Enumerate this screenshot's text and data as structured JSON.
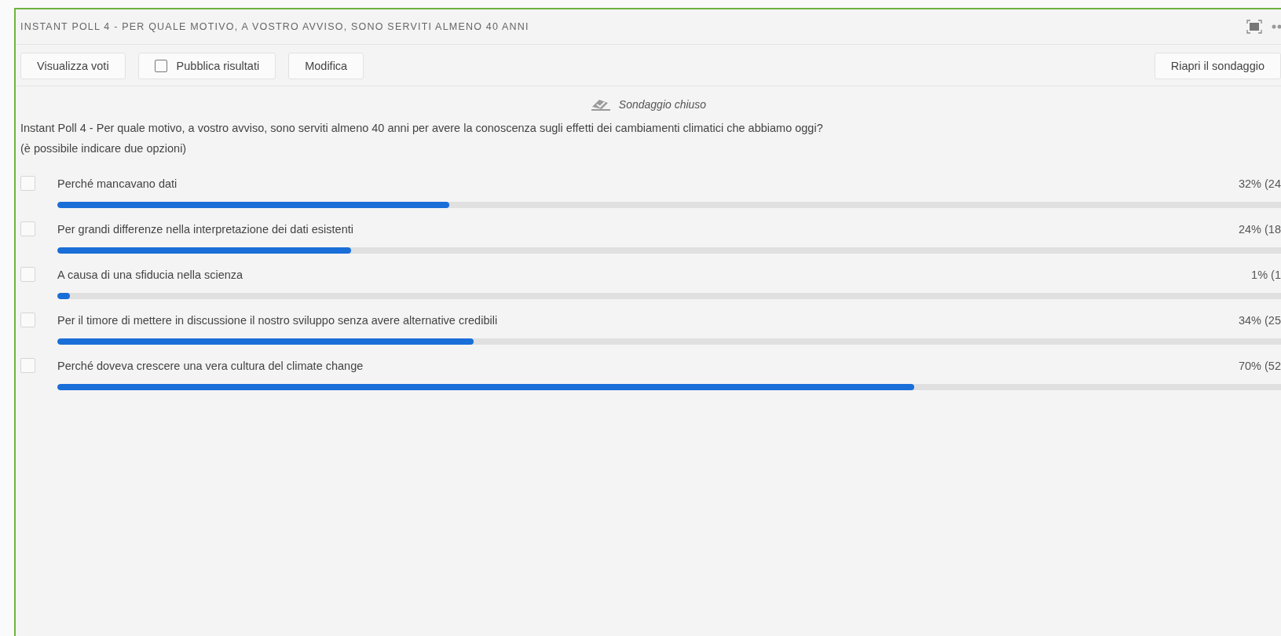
{
  "panel": {
    "title": "INSTANT POLL 4 - PER QUALE MOTIVO, A VOSTRO AVVISO, SONO SERVITI ALMENO 40 ANNI"
  },
  "toolbar": {
    "view_votes": "Visualizza voti",
    "publish": {
      "label": "Pubblica risultati",
      "checked": false
    },
    "edit": "Modifica",
    "reopen": "Riapri il sondaggio"
  },
  "status": "Sondaggio chiuso",
  "question": [
    "Instant Poll 4 - Per quale motivo, a vostro avviso, sono serviti almeno 40 anni per avere la conoscenza sugli effetti dei cambiamenti climatici che abbiamo oggi?",
    "(è possibile indicare due opzioni)"
  ],
  "options": [
    {
      "label": "Perché mancavano dati",
      "checked": false,
      "level": 0.32,
      "result": "32% (24"
    },
    {
      "label": "Per grandi differenze nella interpretazione dei dati esistenti",
      "checked": false,
      "level": 0.24,
      "result": "24% (18"
    },
    {
      "label": "A causa di una sfiducia nella scienza",
      "checked": false,
      "level": 0.01,
      "result": "1% (1"
    },
    {
      "label": "Per il timore di mettere in discussione il nostro sviluppo senza avere alternative credibili",
      "checked": false,
      "level": 0.34,
      "result": "34% (25"
    },
    {
      "label": "Perché doveva crescere una vera cultura del climate change",
      "checked": false,
      "level": 0.7,
      "result": "70% (52"
    }
  ]
}
